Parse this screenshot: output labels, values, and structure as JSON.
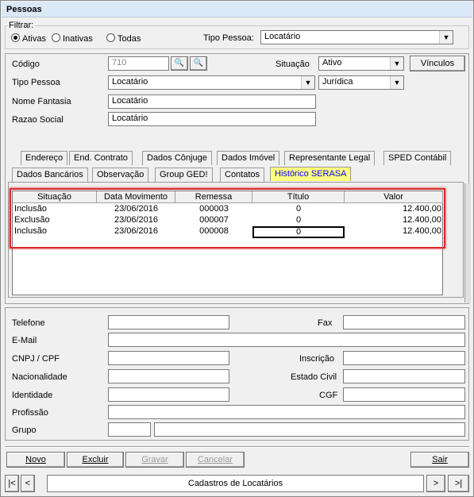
{
  "window": {
    "title": "Pessoas"
  },
  "filter": {
    "legend": "Filtrar:",
    "options": [
      {
        "label": "Ativas",
        "selected": true
      },
      {
        "label": "Inativas",
        "selected": false
      },
      {
        "label": "Todas",
        "selected": false
      }
    ],
    "tipo_label": "Tipo Pessoa:",
    "tipo_value": "Locatário"
  },
  "fields": {
    "codigo_label": "Código",
    "codigo_value": "710",
    "situacao_label": "Situação",
    "situacao_value": "Ativo",
    "vinculos_button": "Vínculos",
    "tipo_pessoa_label": "Tipo Pessoa",
    "tipo_pessoa_value": "Locatário",
    "natureza_value": "Jurídica",
    "nome_fantasia_label": "Nome Fantasia",
    "nome_fantasia_value": "Locatário",
    "razao_social_label": "Razao Social",
    "razao_social_value": "Locatário"
  },
  "tabs": {
    "row1": [
      "Endereço",
      "End. Contrato",
      "Dados Cônjuge",
      "Dados Imóvel",
      "Representante Legal",
      "SPED Contábil"
    ],
    "row2": [
      "Dados Bancários",
      "Observação",
      "Group GED!",
      "Contatos",
      "Histórico SERASA"
    ]
  },
  "grid": {
    "columns": [
      "Situação",
      "Data Movimento",
      "Remessa",
      "Título",
      "Valor"
    ],
    "rows": [
      [
        "Inclusão",
        "23/06/2016",
        "000003",
        "0",
        "12.400,00"
      ],
      [
        "Exclusão",
        "23/06/2016",
        "000007",
        "0",
        "12.400,00"
      ],
      [
        "Inclusão",
        "23/06/2016",
        "000008",
        "0",
        "12.400,00"
      ]
    ]
  },
  "contact": {
    "telefone_label": "Telefone",
    "fax_label": "Fax",
    "email_label": "E-Mail",
    "cnpj_label": "CNPJ / CPF",
    "inscricao_label": "Inscrição",
    "nacionalidade_label": "Nacionalidade",
    "estado_civil_label": "Estado Civil",
    "identidade_label": "Identidade",
    "cgf_label": "CGF",
    "profissao_label": "Profissão",
    "grupo_label": "Grupo"
  },
  "actions": {
    "novo": "Novo",
    "excluir": "Excluir",
    "gravar": "Gravar",
    "cancelar": "Cancelar",
    "sair": "Sair"
  },
  "navigator": {
    "first": "|<",
    "prev": "<",
    "caption": "Cadastros de Locatários",
    "next": ">",
    "last": ">|"
  },
  "colors": {
    "highlight_border": "#d92b2b",
    "active_tab_bg": "#ffff80"
  }
}
